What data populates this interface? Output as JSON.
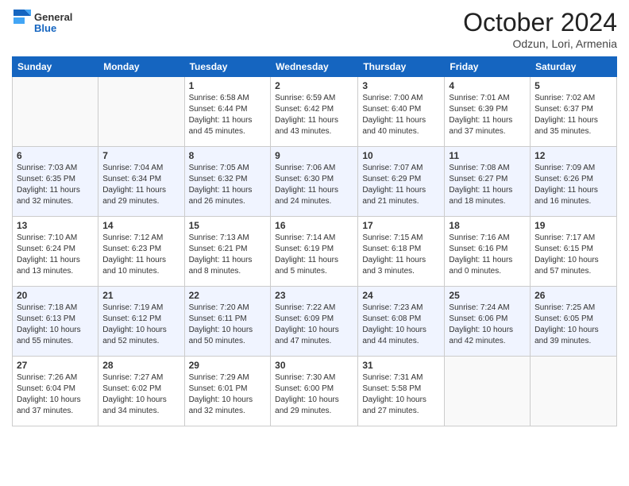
{
  "header": {
    "logo": {
      "general": "General",
      "blue": "Blue",
      "tagline": "GeneralBlue"
    },
    "title": "October 2024",
    "subtitle": "Odzun, Lori, Armenia"
  },
  "weekdays": [
    "Sunday",
    "Monday",
    "Tuesday",
    "Wednesday",
    "Thursday",
    "Friday",
    "Saturday"
  ],
  "weeks": [
    [
      {
        "day": "",
        "empty": true
      },
      {
        "day": "",
        "empty": true
      },
      {
        "day": "1",
        "sunrise": "6:58 AM",
        "sunset": "6:44 PM",
        "daylight": "11 hours and 45 minutes."
      },
      {
        "day": "2",
        "sunrise": "6:59 AM",
        "sunset": "6:42 PM",
        "daylight": "11 hours and 43 minutes."
      },
      {
        "day": "3",
        "sunrise": "7:00 AM",
        "sunset": "6:40 PM",
        "daylight": "11 hours and 40 minutes."
      },
      {
        "day": "4",
        "sunrise": "7:01 AM",
        "sunset": "6:39 PM",
        "daylight": "11 hours and 37 minutes."
      },
      {
        "day": "5",
        "sunrise": "7:02 AM",
        "sunset": "6:37 PM",
        "daylight": "11 hours and 35 minutes."
      }
    ],
    [
      {
        "day": "6",
        "sunrise": "7:03 AM",
        "sunset": "6:35 PM",
        "daylight": "11 hours and 32 minutes."
      },
      {
        "day": "7",
        "sunrise": "7:04 AM",
        "sunset": "6:34 PM",
        "daylight": "11 hours and 29 minutes."
      },
      {
        "day": "8",
        "sunrise": "7:05 AM",
        "sunset": "6:32 PM",
        "daylight": "11 hours and 26 minutes."
      },
      {
        "day": "9",
        "sunrise": "7:06 AM",
        "sunset": "6:30 PM",
        "daylight": "11 hours and 24 minutes."
      },
      {
        "day": "10",
        "sunrise": "7:07 AM",
        "sunset": "6:29 PM",
        "daylight": "11 hours and 21 minutes."
      },
      {
        "day": "11",
        "sunrise": "7:08 AM",
        "sunset": "6:27 PM",
        "daylight": "11 hours and 18 minutes."
      },
      {
        "day": "12",
        "sunrise": "7:09 AM",
        "sunset": "6:26 PM",
        "daylight": "11 hours and 16 minutes."
      }
    ],
    [
      {
        "day": "13",
        "sunrise": "7:10 AM",
        "sunset": "6:24 PM",
        "daylight": "11 hours and 13 minutes."
      },
      {
        "day": "14",
        "sunrise": "7:12 AM",
        "sunset": "6:23 PM",
        "daylight": "11 hours and 10 minutes."
      },
      {
        "day": "15",
        "sunrise": "7:13 AM",
        "sunset": "6:21 PM",
        "daylight": "11 hours and 8 minutes."
      },
      {
        "day": "16",
        "sunrise": "7:14 AM",
        "sunset": "6:19 PM",
        "daylight": "11 hours and 5 minutes."
      },
      {
        "day": "17",
        "sunrise": "7:15 AM",
        "sunset": "6:18 PM",
        "daylight": "11 hours and 3 minutes."
      },
      {
        "day": "18",
        "sunrise": "7:16 AM",
        "sunset": "6:16 PM",
        "daylight": "11 hours and 0 minutes."
      },
      {
        "day": "19",
        "sunrise": "7:17 AM",
        "sunset": "6:15 PM",
        "daylight": "10 hours and 57 minutes."
      }
    ],
    [
      {
        "day": "20",
        "sunrise": "7:18 AM",
        "sunset": "6:13 PM",
        "daylight": "10 hours and 55 minutes."
      },
      {
        "day": "21",
        "sunrise": "7:19 AM",
        "sunset": "6:12 PM",
        "daylight": "10 hours and 52 minutes."
      },
      {
        "day": "22",
        "sunrise": "7:20 AM",
        "sunset": "6:11 PM",
        "daylight": "10 hours and 50 minutes."
      },
      {
        "day": "23",
        "sunrise": "7:22 AM",
        "sunset": "6:09 PM",
        "daylight": "10 hours and 47 minutes."
      },
      {
        "day": "24",
        "sunrise": "7:23 AM",
        "sunset": "6:08 PM",
        "daylight": "10 hours and 44 minutes."
      },
      {
        "day": "25",
        "sunrise": "7:24 AM",
        "sunset": "6:06 PM",
        "daylight": "10 hours and 42 minutes."
      },
      {
        "day": "26",
        "sunrise": "7:25 AM",
        "sunset": "6:05 PM",
        "daylight": "10 hours and 39 minutes."
      }
    ],
    [
      {
        "day": "27",
        "sunrise": "7:26 AM",
        "sunset": "6:04 PM",
        "daylight": "10 hours and 37 minutes."
      },
      {
        "day": "28",
        "sunrise": "7:27 AM",
        "sunset": "6:02 PM",
        "daylight": "10 hours and 34 minutes."
      },
      {
        "day": "29",
        "sunrise": "7:29 AM",
        "sunset": "6:01 PM",
        "daylight": "10 hours and 32 minutes."
      },
      {
        "day": "30",
        "sunrise": "7:30 AM",
        "sunset": "6:00 PM",
        "daylight": "10 hours and 29 minutes."
      },
      {
        "day": "31",
        "sunrise": "7:31 AM",
        "sunset": "5:58 PM",
        "daylight": "10 hours and 27 minutes."
      },
      {
        "day": "",
        "empty": true
      },
      {
        "day": "",
        "empty": true
      }
    ]
  ],
  "labels": {
    "sunrise": "Sunrise:",
    "sunset": "Sunset:",
    "daylight": "Daylight:"
  }
}
